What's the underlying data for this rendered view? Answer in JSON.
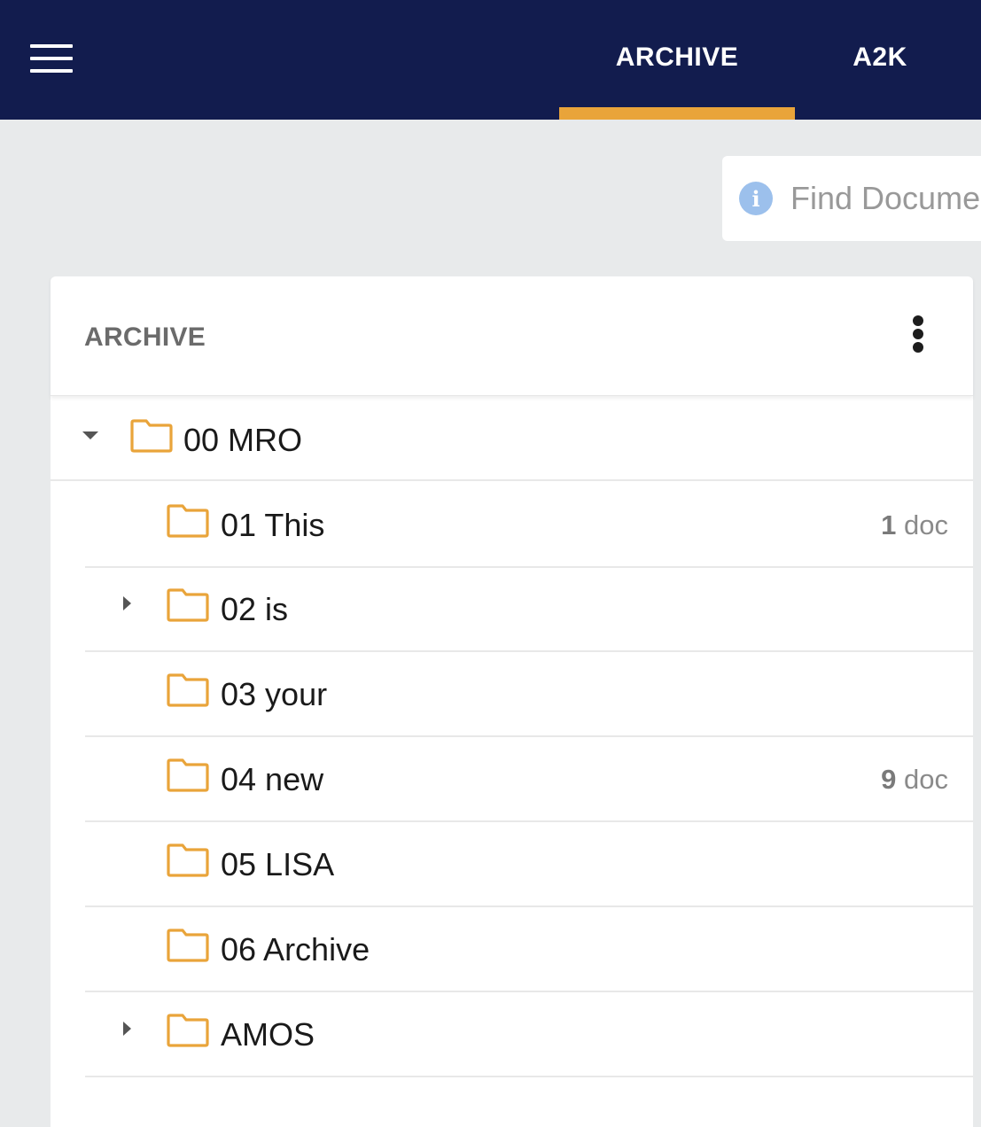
{
  "header": {
    "tabs": [
      {
        "label": "ARCHIVE",
        "active": true
      },
      {
        "label": "A2K",
        "active": false
      }
    ]
  },
  "search": {
    "placeholder": "Find Documents"
  },
  "card": {
    "title": "ARCHIVE",
    "tree": {
      "root": {
        "label": "00 MRO",
        "expanded": true
      },
      "children": [
        {
          "label": "01 This",
          "count": "1",
          "count_unit": "doc",
          "has_children": false
        },
        {
          "label": "02 is",
          "count": "",
          "count_unit": "",
          "has_children": true
        },
        {
          "label": "03 your",
          "count": "",
          "count_unit": "",
          "has_children": false
        },
        {
          "label": "04 new",
          "count": "9",
          "count_unit": "doc",
          "has_children": false
        },
        {
          "label": "05 LISA",
          "count": "",
          "count_unit": "",
          "has_children": false
        },
        {
          "label": "06 Archive",
          "count": "",
          "count_unit": "",
          "has_children": false
        },
        {
          "label": "AMOS",
          "count": "",
          "count_unit": "",
          "has_children": true
        }
      ]
    }
  },
  "colors": {
    "topbar": "#121c4e",
    "accent": "#e9a43a",
    "folder": "#e9a43a",
    "background": "#e8eaeb",
    "info_icon": "#9cc0ec"
  },
  "icons": {
    "menu": "hamburger-menu-icon",
    "info": "info-icon",
    "more": "kebab-menu-icon",
    "folder": "folder-icon",
    "expanded": "caret-down-icon",
    "collapsed": "caret-right-icon"
  }
}
